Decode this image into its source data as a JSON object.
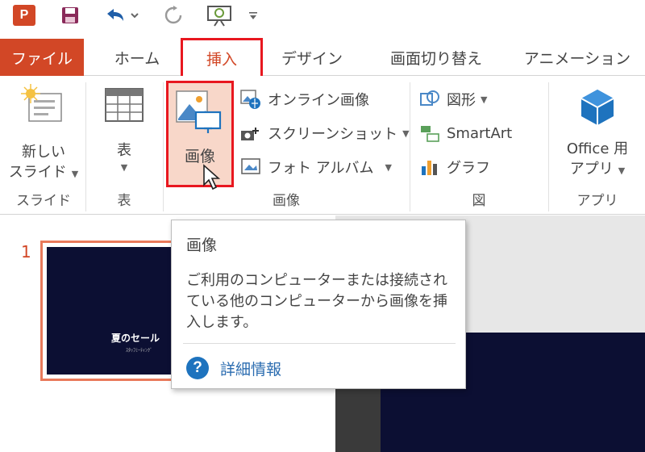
{
  "app": {
    "logo_letter": "P"
  },
  "tabs": {
    "file": "ファイル",
    "home": "ホーム",
    "insert": "挿入",
    "design": "デザイン",
    "transitions": "画面切り替え",
    "animations": "アニメーション"
  },
  "ribbon": {
    "slides": {
      "button_line1": "新しい",
      "button_line2": "スライド",
      "group_label": "スライド"
    },
    "table": {
      "button_label": "表",
      "group_label": "表"
    },
    "images": {
      "picture_label": "画像",
      "online_pictures": "オンライン画像",
      "screenshot": "スクリーンショット",
      "photo_album": "フォト アルバム",
      "group_label": "画像"
    },
    "illustrations": {
      "shapes": "図形",
      "smartart": "SmartArt",
      "chart": "グラフ",
      "group_label": "図"
    },
    "apps": {
      "button_line1": "Office 用",
      "button_line2": "アプリ",
      "group_label": "アプリ"
    }
  },
  "thumbnails": {
    "slide_number": "1",
    "slide_title": "夏のセール",
    "slide_subtitle": "ｽﾀｯﾌﾐｰﾃｨﾝｸﾞ"
  },
  "tooltip": {
    "title": "画像",
    "body": "ご利用のコンピューターまたは接続されている他のコンピューターから画像を挿入します。",
    "help_link": "詳細情報",
    "help_glyph": "?"
  },
  "colors": {
    "accent": "#d24726",
    "highlight_border": "#e8171f",
    "slide_bg": "#0c0f33",
    "link": "#2b6cb0"
  }
}
